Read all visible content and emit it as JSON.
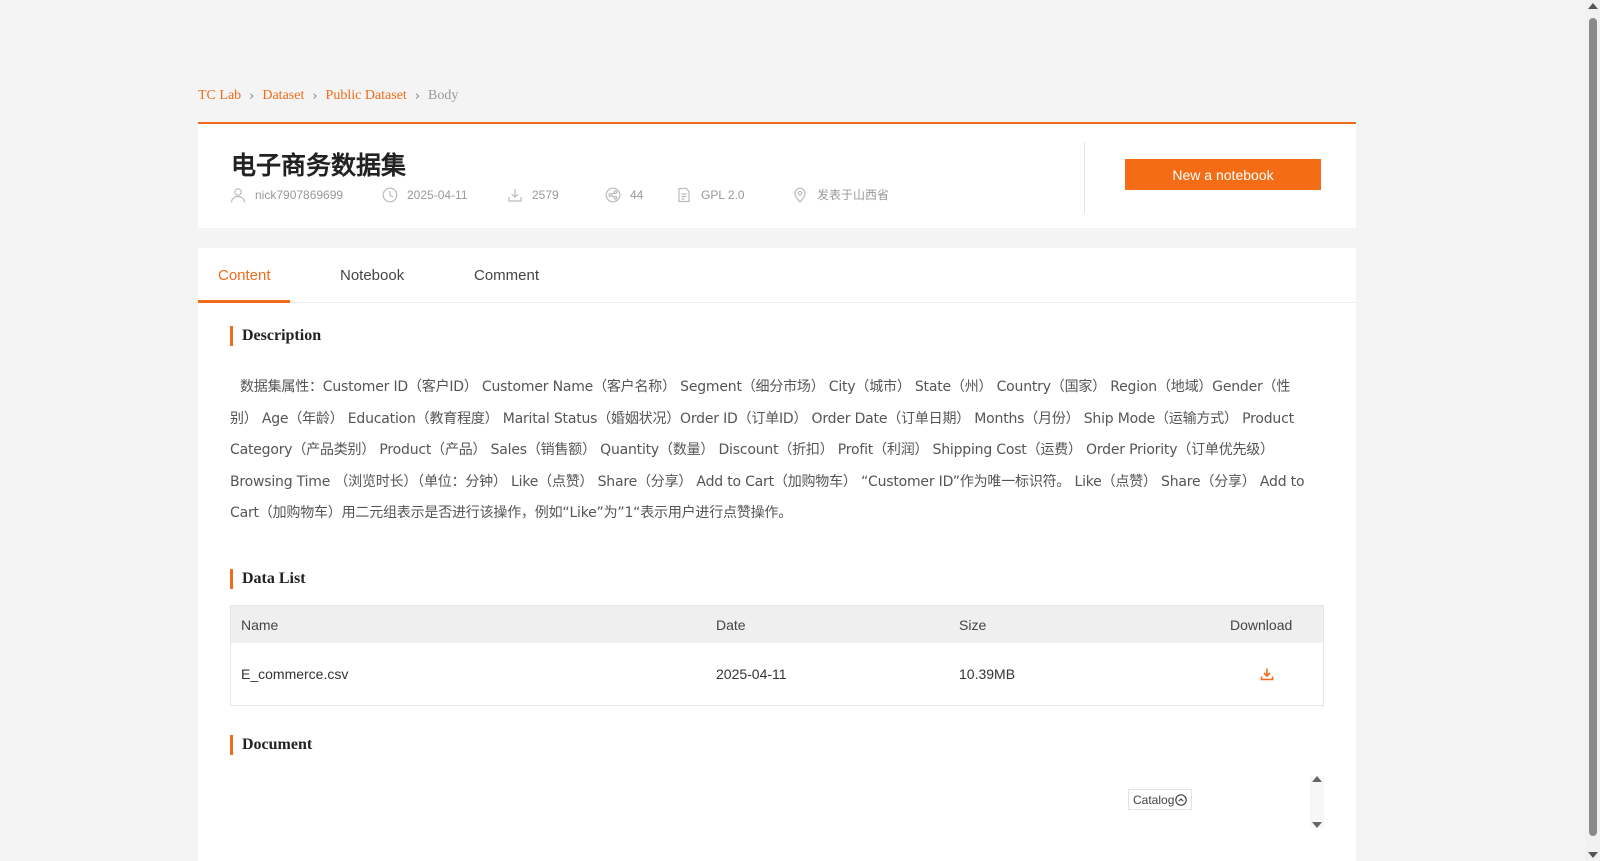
{
  "breadcrumb": {
    "items": [
      "TC Lab",
      "Dataset",
      "Public Dataset"
    ],
    "current": "Body",
    "separator": "›"
  },
  "dataset": {
    "title": "电子商务数据集",
    "author": "nick7907869699",
    "date": "2025-04-11",
    "downloads": "2579",
    "shares": "44",
    "license": "GPL 2.0",
    "location": "发表于山西省",
    "new_notebook_label": "New a notebook"
  },
  "tabs": [
    {
      "label": "Content",
      "active": true
    },
    {
      "label": "Notebook",
      "active": false
    },
    {
      "label": "Comment",
      "active": false
    }
  ],
  "sections": {
    "description_title": "Description",
    "description_text": "数据集属性：Customer ID（客户ID） Customer Name（客户名称） Segment（细分市场） City（城市） State（州） Country（国家） Region（地域）Gender（性别） Age（年龄） Education（教育程度） Marital Status（婚姻状况）Order ID（订单ID） Order Date（订单日期） Months（月份） Ship Mode（运输方式） Product Category（产品类别） Product（产品） Sales（销售额） Quantity（数量） Discount（折扣） Profit（利润） Shipping Cost（运费） Order Priority（订单优先级） Browsing Time （浏览时长）（单位：分钟） Like（点赞） Share（分享） Add to Cart（加购物车） “Customer ID”作为唯一标识符。 Like（点赞） Share（分享） Add to Cart（加购物车）用二元组表示是否进行该操作，例如“Like”为”1“表示用户进行点赞操作。",
    "data_list_title": "Data List",
    "document_title": "Document"
  },
  "table": {
    "headers": [
      "Name",
      "Date",
      "Size",
      "Download"
    ],
    "rows": [
      {
        "name": "E_commerce.csv",
        "date": "2025-04-11",
        "size": "10.39MB"
      }
    ]
  },
  "catalog_label": "Catalog",
  "colors": {
    "accent": "#f06c1a",
    "button": "#f46d16",
    "background": "#f4f4f4"
  },
  "icons": {
    "author": "user-icon",
    "date": "clock-icon",
    "downloads": "download-icon",
    "shares": "share-icon",
    "license": "document-icon",
    "location": "location-pin-icon",
    "table_download": "download-icon",
    "catalog": "chevron-up-circle-icon"
  }
}
